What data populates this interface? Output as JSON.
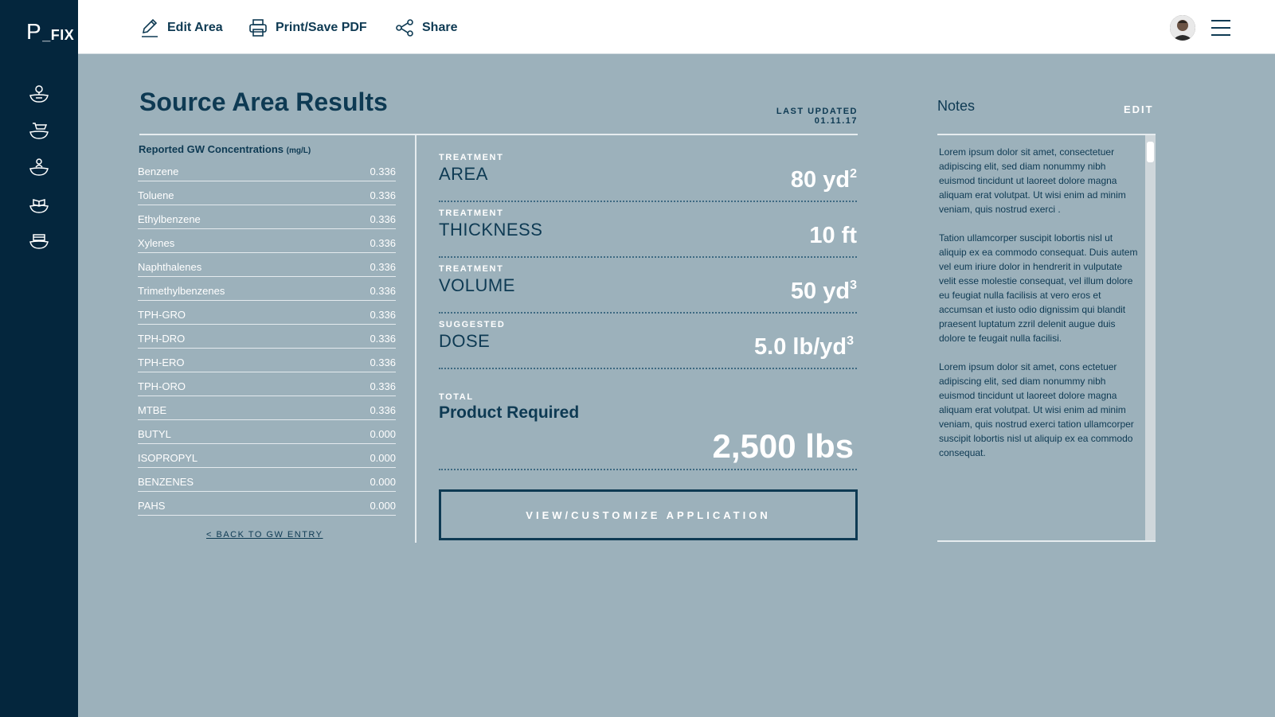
{
  "app": {
    "logo_prefix": "P",
    "logo_suffix": "_FIX"
  },
  "sidebar": {
    "icons": [
      "location-pin-hand-icon",
      "cart-hand-icon",
      "person-hand-icon",
      "book-hand-icon",
      "box-hand-icon"
    ]
  },
  "toolbar": {
    "edit_label": "Edit Area",
    "print_label": "Print/Save PDF",
    "share_label": "Share"
  },
  "page": {
    "title": "Source Area Results",
    "last_updated_label": "LAST UPDATED",
    "last_updated_value": "01.11.17"
  },
  "concentrations": {
    "title": "Reported GW Concentrations",
    "unit": "(mg/L)",
    "rows": [
      {
        "name": "Benzene",
        "value": "0.336"
      },
      {
        "name": "Toluene",
        "value": "0.336"
      },
      {
        "name": "Ethylbenzene",
        "value": "0.336"
      },
      {
        "name": "Xylenes",
        "value": "0.336"
      },
      {
        "name": "Naphthalenes",
        "value": "0.336"
      },
      {
        "name": "Trimethylbenzenes",
        "value": "0.336"
      },
      {
        "name": "TPH-GRO",
        "value": "0.336"
      },
      {
        "name": "TPH-DRO",
        "value": "0.336"
      },
      {
        "name": "TPH-ERO",
        "value": "0.336"
      },
      {
        "name": "TPH-ORO",
        "value": "0.336"
      },
      {
        "name": "MTBE",
        "value": "0.336"
      },
      {
        "name": "BUTYL",
        "value": "0.000"
      },
      {
        "name": "ISOPROPYL",
        "value": "0.000"
      },
      {
        "name": "BENZENES",
        "value": "0.000"
      },
      {
        "name": "PAHS",
        "value": "0.000"
      }
    ],
    "back_link": "<  BACK TO GW ENTRY"
  },
  "metrics": {
    "area": {
      "label": "TREATMENT",
      "name": "AREA",
      "value": "80 yd",
      "sup": "2"
    },
    "thickness": {
      "label": "TREATMENT",
      "name": "THICKNESS",
      "value": "10 ft",
      "sup": ""
    },
    "volume": {
      "label": "TREATMENT",
      "name": "VOLUME",
      "value": "50 yd",
      "sup": "3"
    },
    "dose": {
      "label": "SUGGESTED",
      "name": "DOSE",
      "value": "5.0 lb/yd",
      "sup": "3"
    }
  },
  "total": {
    "label": "TOTAL",
    "name": "Product Required",
    "value": "2,500 lbs"
  },
  "cta_label": "VIEW/CUSTOMIZE APPLICATION",
  "notes": {
    "title": "Notes",
    "edit_label": "EDIT",
    "paragraphs": [
      "Lorem ipsum dolor sit amet, consectetuer adipiscing elit, sed diam nonummy nibh euismod tincidunt ut laoreet dolore magna aliquam erat volutpat. Ut wisi enim ad minim veniam, quis nostrud exerci .",
      "Tation ullamcorper suscipit lobortis nisl ut aliquip ex ea commodo consequat. Duis autem vel eum iriure dolor in hendrerit in vulputate velit esse molestie consequat, vel illum dolore eu feugiat nulla facilisis at vero eros et accumsan et iusto odio dignissim qui blandit praesent luptatum zzril delenit augue duis dolore te feugait nulla facilisi.",
      "Lorem ipsum dolor sit amet, cons ectetuer adipiscing elit, sed diam nonummy nibh euismod tincidunt ut laoreet dolore magna aliquam erat volutpat. Ut wisi enim ad minim veniam, quis nostrud exerci tation ullamcorper suscipit lobortis nisl ut aliquip ex ea commodo consequat."
    ]
  }
}
